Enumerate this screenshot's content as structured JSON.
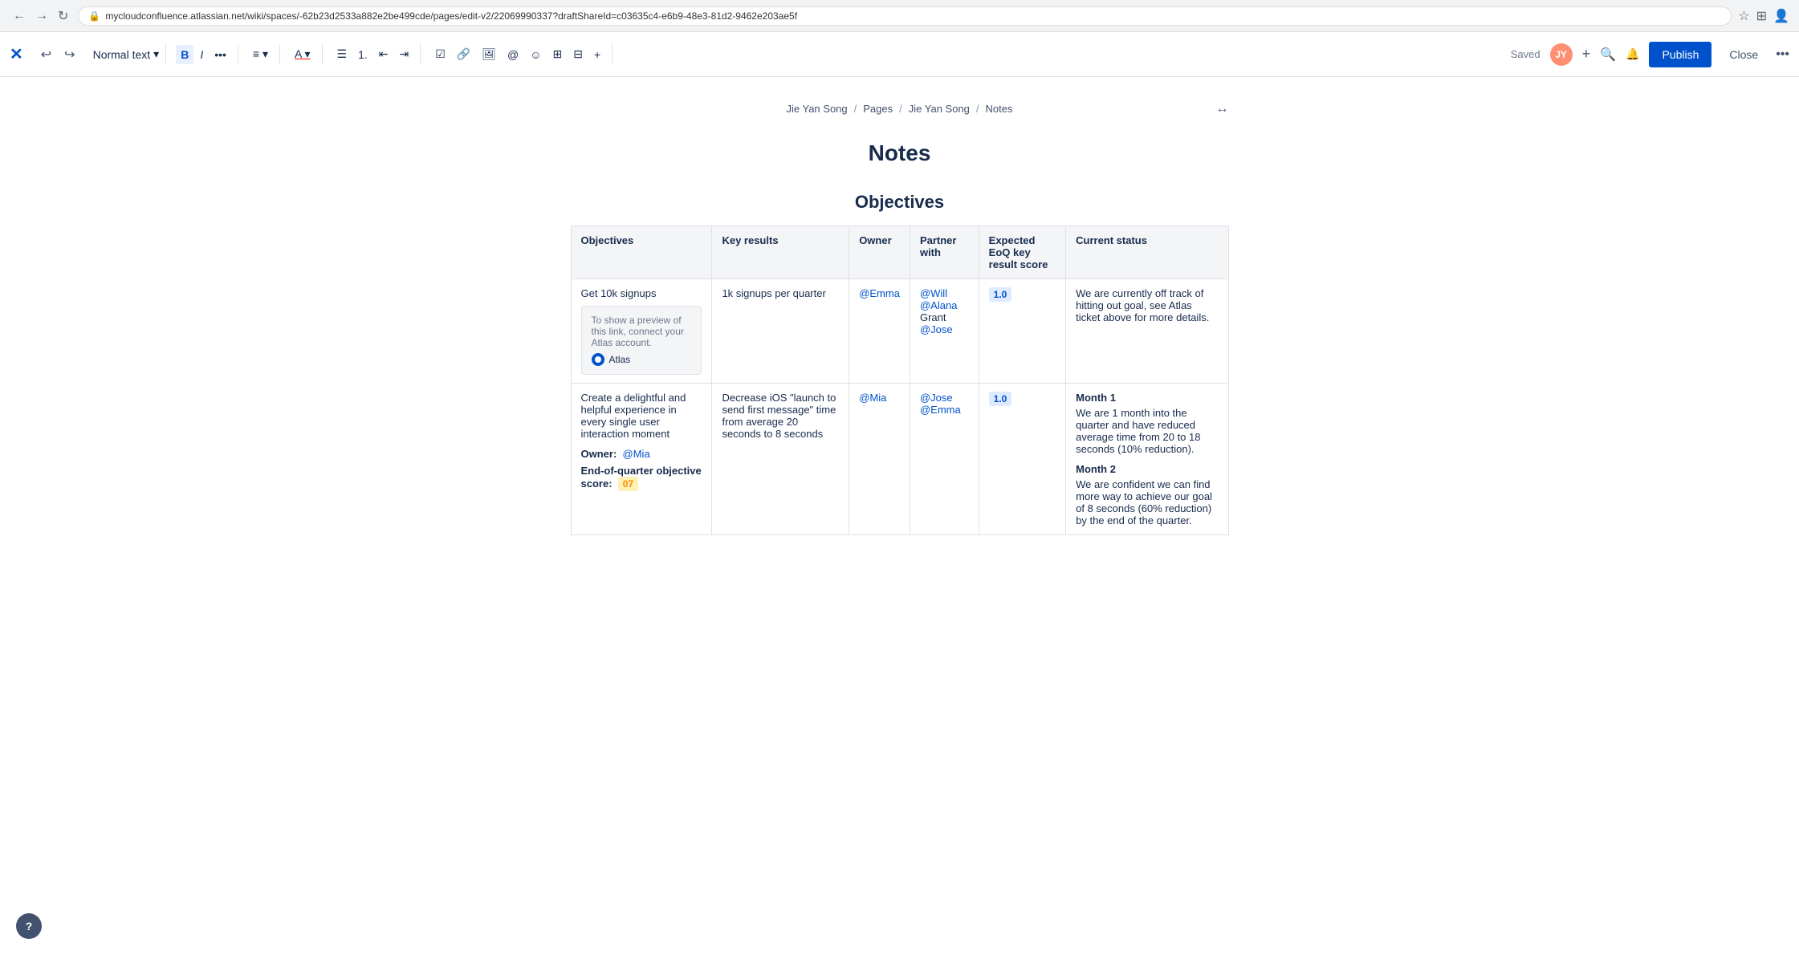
{
  "browser": {
    "url": "mycloudconfluence.atlassian.net/wiki/spaces/-62b23d2533a882e2be499cde/pages/edit-v2/22069990337?draftShareId=c03635c4-e6b9-48e3-81d2-9462e203ae5f",
    "nav_back": "←",
    "nav_forward": "→",
    "nav_refresh": "↻"
  },
  "toolbar": {
    "logo": "✕",
    "undo": "↩",
    "redo": "↪",
    "text_style": "Normal text",
    "chevron": "▾",
    "more_icon": "•••",
    "bold": "B",
    "italic": "I",
    "align_icon": "≡",
    "color_icon": "A",
    "unordered_list": "≡",
    "ordered_list": "1.",
    "outdent": "←",
    "indent": "→",
    "task": "☑",
    "link": "🔗",
    "image": "🖼",
    "mention": "@",
    "emoji": "☺",
    "table": "⊞",
    "layout": "⊟",
    "more": "+",
    "saved_label": "Saved",
    "add_btn": "+",
    "publish_label": "Publish",
    "close_label": "Close",
    "more_options": "•••"
  },
  "breadcrumb": {
    "items": [
      "Jie Yan Song",
      "Pages",
      "Jie Yan Song",
      "Notes"
    ],
    "expand_icon": "↔"
  },
  "page": {
    "title": "Notes",
    "section_heading": "Objectives"
  },
  "table": {
    "headers": [
      "Objectives",
      "Key results",
      "Owner",
      "Partner with",
      "Expected EoQ key result score",
      "Current status"
    ],
    "rows": [
      {
        "objectives_main": "Get 10k signups",
        "objectives_sub_title": "To show a preview of this link, connect your Atlas account.",
        "objectives_sub_logo": "Atlas",
        "key_results": "1k signups per quarter",
        "owner": "@Emma",
        "partner_with": "@Will  @Alana  Grant  @Jose",
        "partner_with_list": [
          "@Will",
          "@Alana",
          "Grant",
          "@Jose"
        ],
        "score": "1.0",
        "score_type": "blue",
        "current_status": "We are currently off track of hitting out goal, see Atlas ticket above for more details."
      },
      {
        "objectives_main": "Create a delightful and helpful experience in every single user interaction moment",
        "owner_label": "Owner:",
        "owner_value": "@Mia",
        "eoq_label": "End-of-quarter objective score:",
        "eoq_value": "07",
        "key_results": "Decrease iOS \"launch to send first message\" time from average 20 seconds to 8 seconds",
        "owner": "@Mia",
        "partner_with_list": [
          "@Jose",
          "@Emma"
        ],
        "score": "1.0",
        "score_type": "blue",
        "month1_heading": "Month 1",
        "month1_text": "We are 1 month into the quarter and have reduced average time from 20 to 18 seconds (10% reduction).",
        "month2_heading": "Month 2",
        "month2_text": "We are confident we can find more way to achieve our goal of 8 seconds (60% reduction) by the end of the quarter."
      }
    ]
  }
}
